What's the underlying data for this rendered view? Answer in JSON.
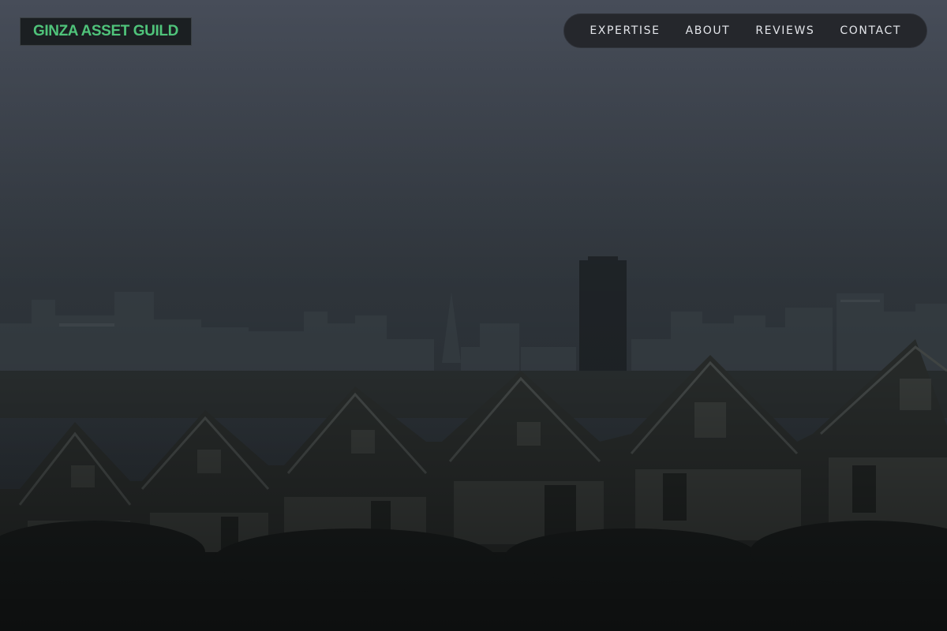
{
  "brand": {
    "name": "GINZA ASSET GUILD",
    "color": "#4fc37a"
  },
  "nav": {
    "items": [
      {
        "id": "expertise",
        "label": "EXPERTISE"
      },
      {
        "id": "about",
        "label": "ABOUT"
      },
      {
        "id": "reviews",
        "label": "REVIEWS"
      },
      {
        "id": "contact",
        "label": "CONTACT"
      }
    ]
  },
  "hero": {
    "image": "city-skyline-with-victorian-houses",
    "overlay_colors": [
      "#464c58",
      "#2f363b",
      "#0f1413"
    ]
  }
}
